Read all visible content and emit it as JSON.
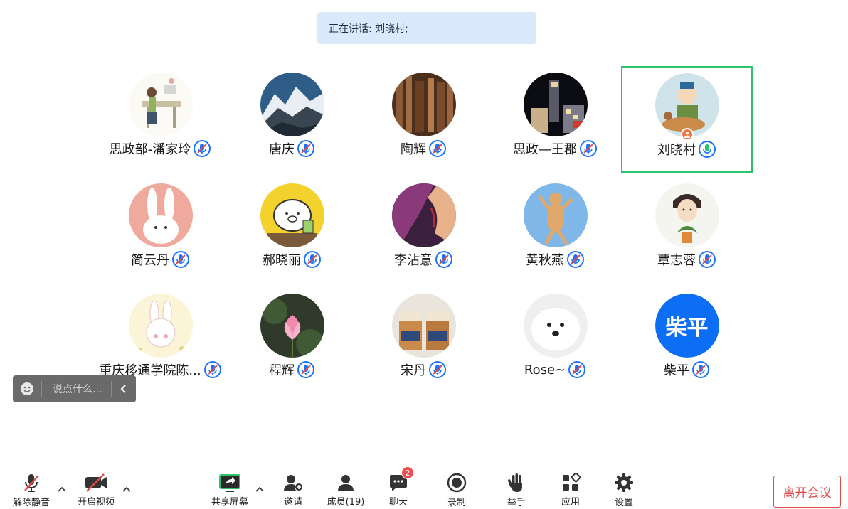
{
  "speaking": {
    "text": "正在讲话: 刘晓村;"
  },
  "participants": [
    {
      "name": "思政部-潘家玲",
      "mic": "muted"
    },
    {
      "name": "唐庆",
      "mic": "muted"
    },
    {
      "name": "陶辉",
      "mic": "muted"
    },
    {
      "name": "思政—王郡",
      "mic": "muted"
    },
    {
      "name": "刘晓村",
      "mic": "speaking"
    },
    {
      "name": "简云丹",
      "mic": "muted"
    },
    {
      "name": "郝晓丽",
      "mic": "muted"
    },
    {
      "name": "李沾意",
      "mic": "muted"
    },
    {
      "name": "黄秋燕",
      "mic": "muted"
    },
    {
      "name": "覃志蓉",
      "mic": "muted"
    },
    {
      "name": "重庆移通学院陈...",
      "mic": "muted"
    },
    {
      "name": "程辉",
      "mic": "muted"
    },
    {
      "name": "宋丹",
      "mic": "muted"
    },
    {
      "name": "Rose~",
      "mic": "muted"
    },
    {
      "name": "柴平",
      "mic": "muted",
      "avatar_text": "柴平"
    }
  ],
  "chat": {
    "placeholder": "说点什么..."
  },
  "toolbar": {
    "unmute": "解除静音",
    "start_video": "开启视频",
    "share_screen": "共享屏幕",
    "invite": "邀请",
    "members": "成员(19)",
    "chat": "聊天",
    "chat_badge": "2",
    "record": "录制",
    "raise_hand": "举手",
    "apps": "应用",
    "settings": "设置",
    "leave": "离开会议"
  },
  "colors": {
    "accent": "#0b6ef5",
    "speaking_border": "#2ec26a",
    "mute_red": "#e24a4a",
    "banner_bg": "#dbe9fd"
  }
}
